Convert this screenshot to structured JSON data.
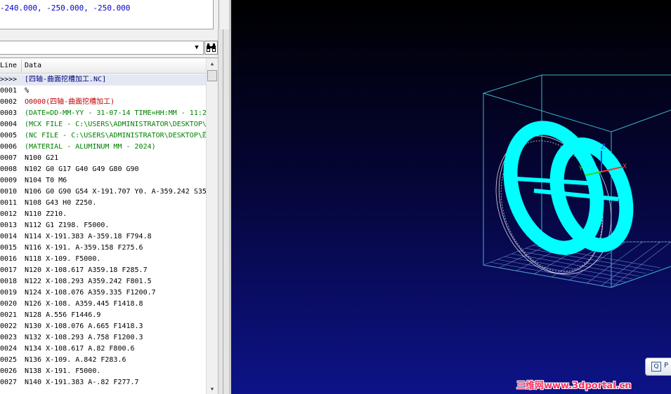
{
  "coords": {
    "text": "-240.000, -250.000, -250.000"
  },
  "toolbar": {
    "filter_value": "",
    "combo_arrow": "▼",
    "find_icon": "binoculars-icon",
    "find_glyph": "⚲"
  },
  "table": {
    "header_line": "Line",
    "header_data": "Data",
    "rows": [
      {
        "line": ">>>>",
        "data": "[四轴-曲面挖槽加工.NC]",
        "color": "navy",
        "selected": true
      },
      {
        "line": "0001",
        "data": "%",
        "color": "black"
      },
      {
        "line": "0002",
        "data": "O0000(四轴-曲面挖槽加工)",
        "color": "red"
      },
      {
        "line": "0003",
        "data": "(DATE=DD-MM-YY - 31-07-14 TIME=HH:MM - 11:2",
        "color": "green"
      },
      {
        "line": "0004",
        "data": "(MCX FILE - C:\\USERS\\ADMINISTRATOR\\DESKTOP\\",
        "color": "green"
      },
      {
        "line": "0005",
        "data": "(NC FILE - C:\\USERS\\ADMINISTRATOR\\DESKTOP\\四",
        "color": "green"
      },
      {
        "line": "0006",
        "data": "(MATERIAL - ALUMINUM MM - 2024)",
        "color": "green"
      },
      {
        "line": "0007",
        "data": "N100 G21",
        "color": "black"
      },
      {
        "line": "0008",
        "data": "N102 G0 G17 G40 G49 G80 G90",
        "color": "black"
      },
      {
        "line": "0009",
        "data": "N104 T0 M6",
        "color": "black"
      },
      {
        "line": "0010",
        "data": "N106 G0 G90 G54 X-191.707 Y0. A-359.242 S35",
        "color": "black"
      },
      {
        "line": "0011",
        "data": "N108 G43 H0 Z250.",
        "color": "black"
      },
      {
        "line": "0012",
        "data": "N110 Z210.",
        "color": "black"
      },
      {
        "line": "0013",
        "data": "N112 G1 Z198. F5000.",
        "color": "black"
      },
      {
        "line": "0014",
        "data": "N114 X-191.383 A-359.18 F794.8",
        "color": "black"
      },
      {
        "line": "0015",
        "data": "N116 X-191. A-359.158 F275.6",
        "color": "black"
      },
      {
        "line": "0016",
        "data": "N118 X-109. F5000.",
        "color": "black"
      },
      {
        "line": "0017",
        "data": "N120 X-108.617 A359.18 F285.7",
        "color": "black"
      },
      {
        "line": "0018",
        "data": "N122 X-108.293 A359.242 F801.5",
        "color": "black"
      },
      {
        "line": "0019",
        "data": "N124 X-108.076 A359.335 F1200.7",
        "color": "black"
      },
      {
        "line": "0020",
        "data": "N126 X-108. A359.445 F1418.8",
        "color": "black"
      },
      {
        "line": "0021",
        "data": "N128 A.556 F1446.9",
        "color": "black"
      },
      {
        "line": "0022",
        "data": "N130 X-108.076 A.665 F1418.3",
        "color": "black"
      },
      {
        "line": "0023",
        "data": "N132 X-108.293 A.758 F1200.3",
        "color": "black"
      },
      {
        "line": "0024",
        "data": "N134 X-108.617 A.82 F800.6",
        "color": "black"
      },
      {
        "line": "0025",
        "data": "N136 X-109. A.842 F283.6",
        "color": "black"
      },
      {
        "line": "0026",
        "data": "N138 X-191. F5000.",
        "color": "black"
      },
      {
        "line": "0027",
        "data": "N140 X-191.383 A-.82 F277.7",
        "color": "black"
      }
    ]
  },
  "viewport": {
    "axis_z": "Z",
    "axis_x": "X",
    "axis_y": "Y",
    "toolpath_color": "#00ffff",
    "stock_color": "#40c0d0",
    "button_glyph": "Q",
    "button_label": "P"
  },
  "watermark": {
    "text": "三维网www.3dportal.cn"
  }
}
